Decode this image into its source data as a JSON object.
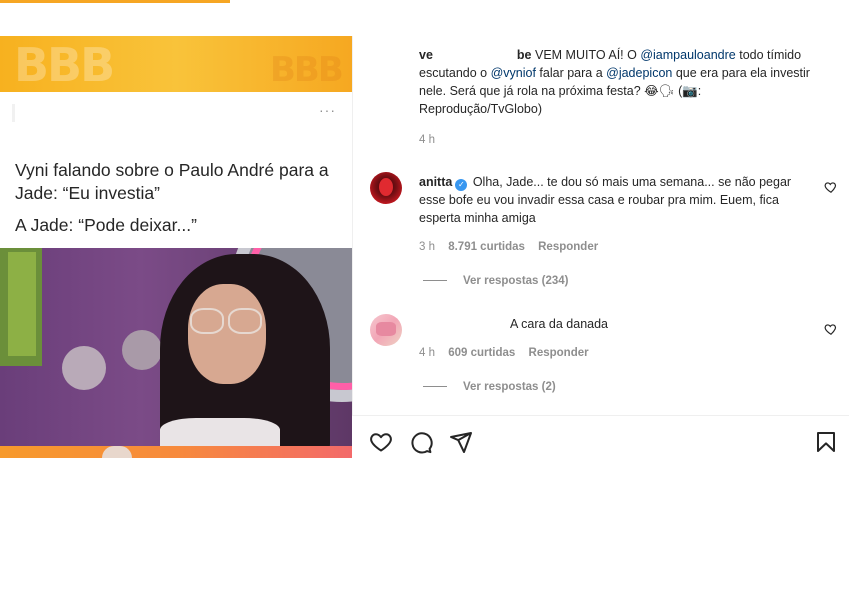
{
  "post": {
    "media_caption": {
      "line1": "Vyni falando sobre o Paulo André para a Jade: “Eu investia”",
      "line2": "A Jade: “Pode deixar...”"
    },
    "media_menu": "···",
    "caption": {
      "username_start": "ve",
      "username_end": "be",
      "text_1": "VEM MUITO AÍ! O",
      "mention_1": "@iampauloandre",
      "text_2": "todo tímido escutando o",
      "mention_2": "@vyniof",
      "text_3": "falar para a",
      "mention_3": "@jadepicon",
      "text_4": "que era para ela investir nele. Será que já rola na próxima festa? 😂🗣 (📷: Reprodução/TvGlobo)",
      "time": "4 h"
    }
  },
  "comments": [
    {
      "username": "anitta",
      "verified": true,
      "text": "Olha, Jade... te dou só mais uma semana... se não pegar esse bofe eu vou invadir essa casa e roubar pra mim. Euem, fica esperta minha amiga",
      "time": "3 h",
      "likes": "8.791 curtidas",
      "reply_label": "Responder",
      "view_replies": "Ver respostas (234)"
    },
    {
      "username": "",
      "text": "A cara da danada",
      "time": "4 h",
      "likes": "609 curtidas",
      "reply_label": "Responder",
      "view_replies": "Ver respostas (2)"
    }
  ],
  "icons": {
    "like": "heart-icon",
    "comment": "comment-icon",
    "share": "paper-plane-icon",
    "save": "bookmark-icon",
    "verified": "verified-badge-icon"
  },
  "colors": {
    "mention": "#00376b",
    "muted": "#8e8e8e",
    "verified": "#3897f0",
    "banner": "#f9c33a"
  }
}
